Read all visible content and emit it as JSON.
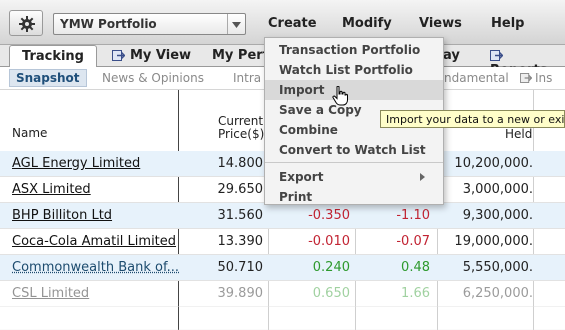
{
  "toolbar": {
    "portfolio_select": "YMW Portfolio",
    "menus": [
      "Create",
      "Modify",
      "Views",
      "Help"
    ]
  },
  "tabs": [
    {
      "label": "Tracking",
      "icon": "none",
      "active": true
    },
    {
      "label": "My View",
      "icon": "arrow-tab-icon"
    },
    {
      "label": "My Perfo",
      "icon": "none"
    },
    {
      "label": "ay",
      "icon": "none"
    },
    {
      "label": "Reports",
      "icon": "arrow-tab-icon"
    }
  ],
  "subtabs": [
    {
      "label": "Snapshot",
      "active": true
    },
    {
      "label": "News & Opinions"
    },
    {
      "label": "Intra"
    },
    {
      "label": "ndamental"
    },
    {
      "label": "Ins",
      "icon": "arrow-tab-icon"
    }
  ],
  "table": {
    "headers": {
      "name": "Name",
      "price_line1": "Current",
      "price_line2": "Price($)",
      "held": "Held"
    },
    "rows": [
      {
        "name": "AGL Energy Limited",
        "price": "14.800",
        "change": "",
        "change_pct": "",
        "held": "10,200,000.",
        "style": "normal"
      },
      {
        "name": "ASX Limited",
        "price": "29.650",
        "change": "",
        "change_pct": "",
        "held": "3,000,000.",
        "style": "normal"
      },
      {
        "name": "BHP Billiton Ltd",
        "price": "31.560",
        "change": "-0.350",
        "change_pct": "-1.10",
        "held": "9,300,000.",
        "style": "neg"
      },
      {
        "name": "Coca-Cola Amatil Limited",
        "price": "13.390",
        "change": "-0.010",
        "change_pct": "-0.07",
        "held": "19,000,000.",
        "style": "neg"
      },
      {
        "name": "Commonwealth Bank of...",
        "price": "50.710",
        "change": "0.240",
        "change_pct": "0.48",
        "held": "5,550,000.",
        "style": "pos"
      },
      {
        "name": "CSL Limited",
        "price": "39.890",
        "change": "0.650",
        "change_pct": "1.66",
        "held": "6,250,000.",
        "style": "pos"
      }
    ]
  },
  "dropdown": {
    "items": [
      {
        "label": "Transaction Portfolio",
        "state": "normal"
      },
      {
        "label": "Watch List Portfolio",
        "state": "normal"
      },
      {
        "label": "Import",
        "state": "hover"
      },
      {
        "label": "Save a Copy",
        "state": "normal"
      },
      {
        "label": "Combine",
        "state": "normal"
      },
      {
        "label": "Convert to Watch List",
        "state": "normal"
      },
      {
        "label": "Export",
        "state": "submenu"
      },
      {
        "label": "Print",
        "state": "normal"
      }
    ]
  },
  "tooltip": "Import your data to a new or exist",
  "colors": {
    "negative": "#c22433",
    "positive": "#2e9a2e",
    "row_highlight": "#e7f2fb",
    "tooltip_bg": "#fffec9"
  }
}
